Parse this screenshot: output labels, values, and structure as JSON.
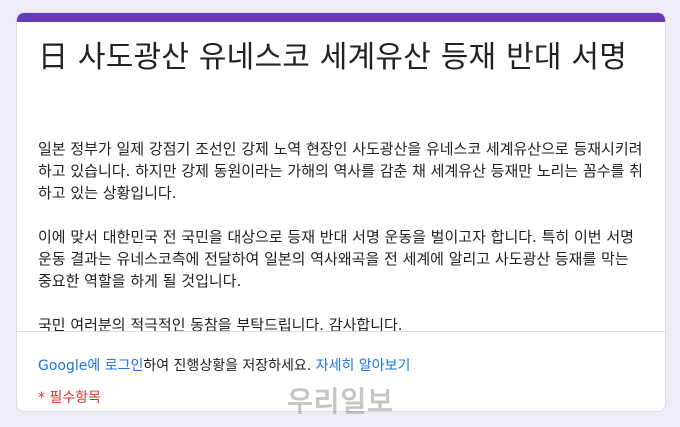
{
  "form": {
    "accent_color": "#673ab7",
    "title": "日 사도광산 유네스코 세계유산 등재 반대 서명",
    "description": [
      "일본 정부가 일제 강점기 조선인 강제 노역 현장인 사도광산을 유네스코 세계유산으로 등재시키려 하고 있습니다. 하지만 강제 동원이라는 가해의 역사를 감춘 채 세계유산 등재만 노리는 꼼수를 취하고 있는 상황입니다.",
      "이에 맞서 대한민국 전 국민을 대상으로 등재 반대 서명 운동을 벌이고자 합니다. 특히 이번 서명 운동 결과는 유네스코측에 전달하여 일본의 역사왜곡을 전 세계에 알리고 사도광산 등재를 막는 중요한 역할을 하게 될 것입니다.",
      "국민 여러분의 적극적인 동참을 부탁드립니다. 감사합니다."
    ],
    "login": {
      "google_link": "Google에 로그인",
      "middle_text": "하여 진행상황을 저장하세요. ",
      "learn_more_link": "자세히 알아보기"
    },
    "required_note": "* 필수항목"
  },
  "watermark": "우리일보"
}
